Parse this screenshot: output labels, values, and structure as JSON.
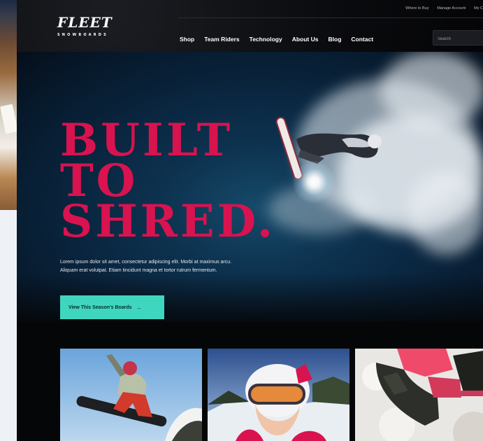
{
  "brand": {
    "logo_main": "FLEET",
    "logo_sub": "SNOWBOARDS"
  },
  "utility_nav": [
    "Where to Buy",
    "Manage Account",
    "My C"
  ],
  "nav": [
    "Shop",
    "Team Riders",
    "Technology",
    "About Us",
    "Blog",
    "Contact"
  ],
  "search": {
    "placeholder": "Search"
  },
  "hero": {
    "headline": [
      "BUILT",
      "TO",
      "SHRED."
    ],
    "body": "Lorem ipsum dolor sit amet, consectetur adipiscing elit. Morbi at maximus arcu. Aliquam erat volutpat. Etiam tincidunt magna et tortor rutrum fermentum.",
    "cta_label": "View This Season's Boards",
    "cta_icon": "arrow-right-icon",
    "headline_color": "#d8134f",
    "cta_color": "#3fd6bf"
  },
  "thumbnails": [
    "snowboarder-jump-photo",
    "skier-goggles-photo",
    "boots-binding-photo"
  ]
}
